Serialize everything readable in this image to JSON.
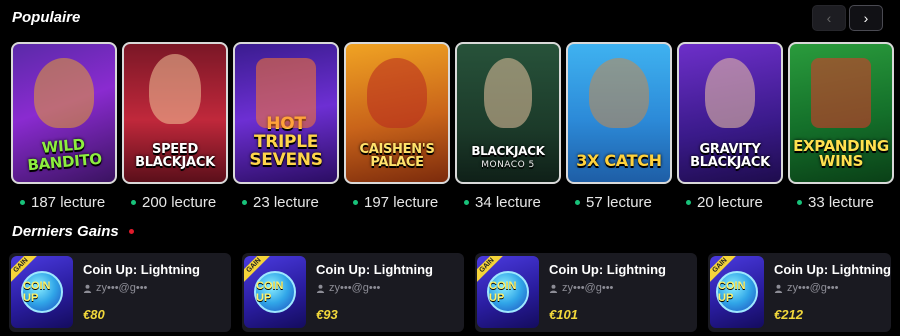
{
  "popular": {
    "title": "Populaire",
    "nav": {
      "prev_icon": "‹",
      "next_icon": "›"
    },
    "games": [
      {
        "title": "Wild Bandito",
        "plays": "187 lecture",
        "subtitle": ""
      },
      {
        "title": "Speed Blackjack",
        "plays": "200 lecture",
        "subtitle": ""
      },
      {
        "title": "Hot Triple Sevens",
        "plays": "23 lecture",
        "subtitle": ""
      },
      {
        "title": "Caishen's Palace",
        "plays": "197 lecture",
        "subtitle": ""
      },
      {
        "title": "Blackjack",
        "plays": "34 lecture",
        "subtitle": "Monaco 5"
      },
      {
        "title": "3x Catch",
        "plays": "57 lecture",
        "subtitle": ""
      },
      {
        "title": "Gravity Blackjack",
        "plays": "20 lecture",
        "subtitle": ""
      },
      {
        "title": "Expanding Wins",
        "plays": "33 lecture",
        "subtitle": ""
      }
    ]
  },
  "wins": {
    "title": "Derniers Gains",
    "items": [
      {
        "game": "Coin Up: Lightning",
        "user": "zy•••@g•••",
        "amount": "€80",
        "badge": "GAIN",
        "thumb_label": "COIN UP"
      },
      {
        "game": "Coin Up: Lightning",
        "user": "zy•••@g•••",
        "amount": "€93",
        "badge": "GAIN",
        "thumb_label": "COIN UP"
      },
      {
        "game": "Coin Up: Lightning",
        "user": "zy•••@g•••",
        "amount": "€101",
        "badge": "GAIN",
        "thumb_label": "COIN UP"
      },
      {
        "game": "Coin Up: Lightning",
        "user": "zy•••@g•••",
        "amount": "€212",
        "badge": "GAIN",
        "thumb_label": "COIN UP"
      }
    ]
  }
}
